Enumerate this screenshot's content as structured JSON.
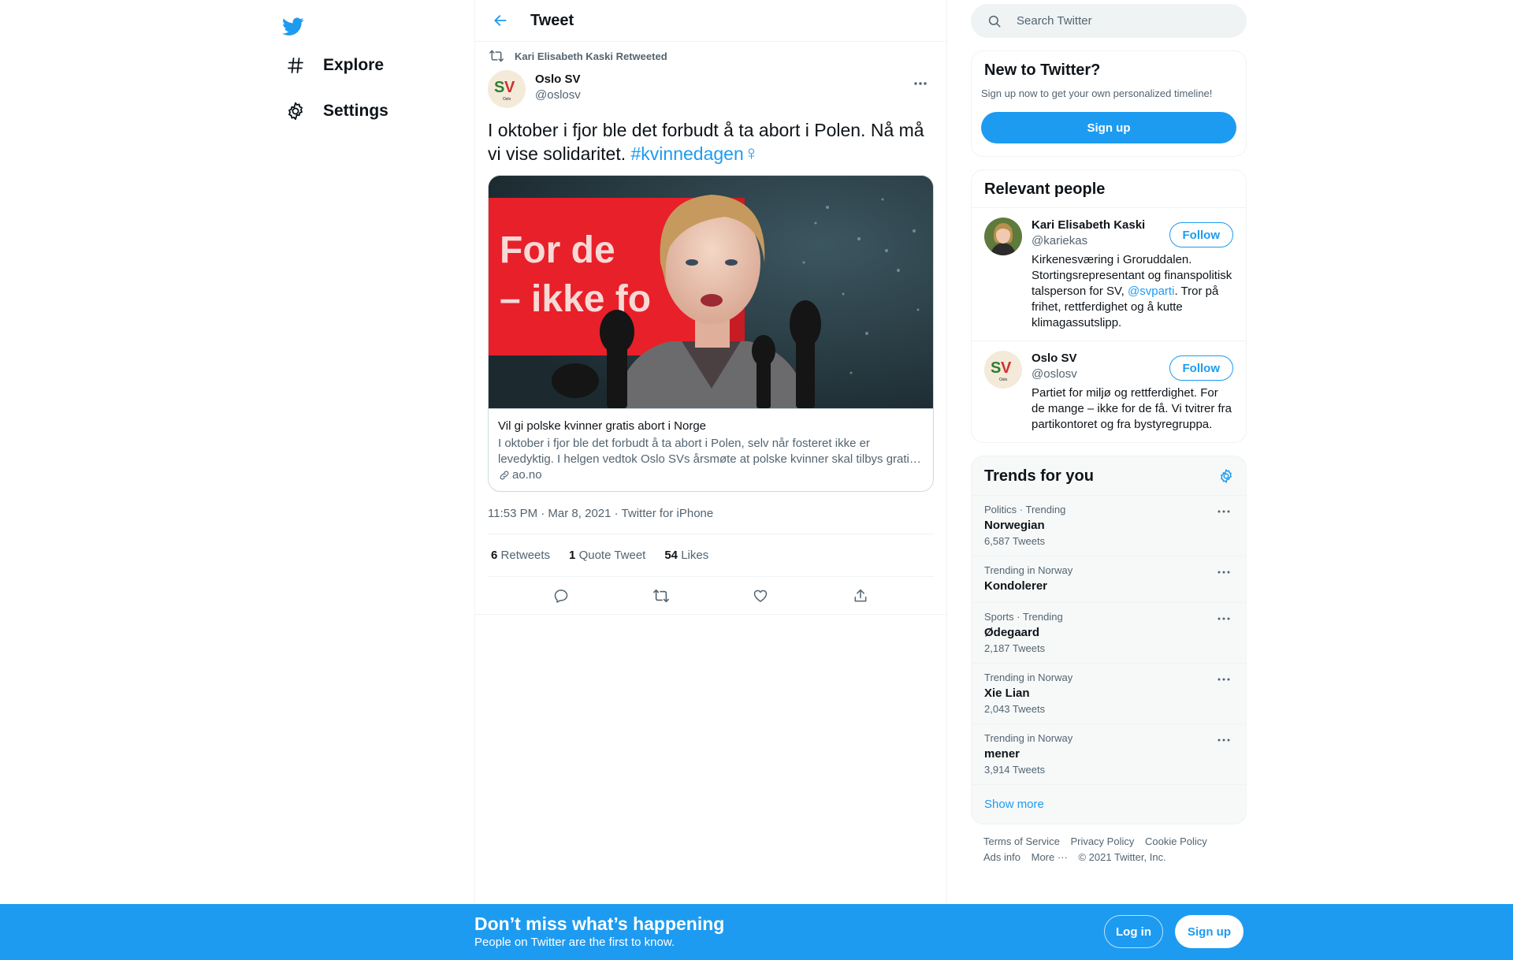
{
  "nav": {
    "items": [
      {
        "label": "Explore",
        "icon": "hashtag-icon"
      },
      {
        "label": "Settings",
        "icon": "gear-icon"
      }
    ]
  },
  "header": {
    "title": "Tweet"
  },
  "tweet": {
    "retweet_context": "Kari Elisabeth Kaski Retweeted",
    "author_name": "Oslo SV",
    "author_handle": "@oslosv",
    "avatar_text": "SV",
    "avatar_subtext": "Oslo",
    "text": "I oktober i fjor ble det forbudt å ta abort i Polen. Nå må vi vise solidaritet.",
    "hashtag": "#kvinnedagen",
    "emoji": "♀",
    "card": {
      "image_sign_line1": "For de",
      "image_sign_line2": "– ikke fo",
      "title": "Vil gi polske kvinner gratis abort i Norge",
      "description": "I oktober i fjor ble det forbudt å ta abort i Polen, selv når fosteret ikke er levedyktig. I helgen vedtok Oslo SVs årsmøte at polske kvinner skal tilbys grati…",
      "domain": "ao.no"
    },
    "timestamp": "11:53 PM · Mar 8, 2021 · Twitter for iPhone",
    "stats": {
      "retweets_count": "6",
      "retweets_label": "Retweets",
      "quotes_count": "1",
      "quotes_label": "Quote Tweet",
      "likes_count": "54",
      "likes_label": "Likes"
    }
  },
  "search": {
    "placeholder": "Search Twitter"
  },
  "new_to_twitter": {
    "title": "New to Twitter?",
    "subtitle": "Sign up now to get your own personalized timeline!",
    "button": "Sign up"
  },
  "relevant_people": {
    "title": "Relevant people",
    "people": [
      {
        "name": "Kari Elisabeth Kaski",
        "handle": "@kariekas",
        "bio_before": "Kirkenesværing i Groruddalen. Stortingsrepresentant og finanspolitisk talsperson for SV, ",
        "bio_mention": "@svparti",
        "bio_after": ". Tror på frihet, rettferdighet og å kutte klimagassutslipp.",
        "follow": "Follow"
      },
      {
        "name": "Oslo SV",
        "handle": "@oslosv",
        "bio_before": "Partiet for miljø og rettferdighet. For de mange – ikke for de få. Vi tvitrer fra partikontoret og fra bystyregruppa.",
        "bio_mention": "",
        "bio_after": "",
        "follow": "Follow"
      }
    ]
  },
  "trends": {
    "title": "Trends for you",
    "items": [
      {
        "context": "Politics · Trending",
        "name": "Norwegian",
        "count": "6,587 Tweets"
      },
      {
        "context": "Trending in Norway",
        "name": "Kondolerer",
        "count": ""
      },
      {
        "context": "Sports · Trending",
        "name": "Ødegaard",
        "count": "2,187 Tweets"
      },
      {
        "context": "Trending in Norway",
        "name": "Xie Lian",
        "count": "2,043 Tweets"
      },
      {
        "context": "Trending in Norway",
        "name": "mener",
        "count": "3,914 Tweets"
      }
    ],
    "show_more": "Show more"
  },
  "footer": {
    "terms": "Terms of Service",
    "privacy": "Privacy Policy",
    "cookie": "Cookie Policy",
    "ads": "Ads info",
    "more": "More ···",
    "copyright": "© 2021 Twitter, Inc."
  },
  "bottom_bar": {
    "title": "Don’t miss what’s happening",
    "subtitle": "People on Twitter are the first to know.",
    "login": "Log in",
    "signup": "Sign up"
  },
  "colors": {
    "brand": "#1d9bf0",
    "text": "#0f1419",
    "muted": "#536471",
    "border": "#eff3f4"
  }
}
